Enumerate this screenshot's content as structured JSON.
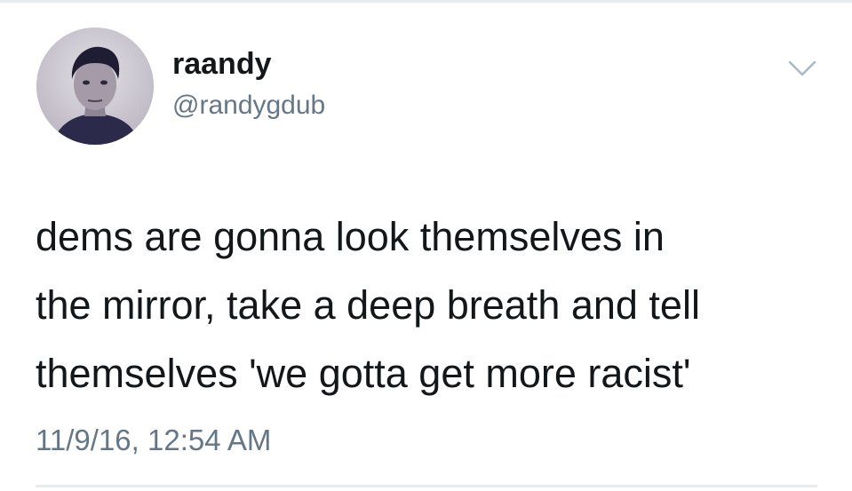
{
  "author": {
    "display_name": "raandy",
    "handle": "@randygdub"
  },
  "tweet": {
    "text_lines": [
      "dems are gonna look themselves in",
      "the mirror, take a deep breath and tell",
      "themselves 'we gotta get more racist'"
    ],
    "timestamp": "11/9/16, 12:54 AM"
  },
  "icons": {
    "menu": "chevron-down-icon",
    "avatar": "avatar"
  },
  "colors": {
    "text": "#14171a",
    "secondary_text": "#657786",
    "divider": "#e6ecf0",
    "chevron": "#aab8c2"
  }
}
